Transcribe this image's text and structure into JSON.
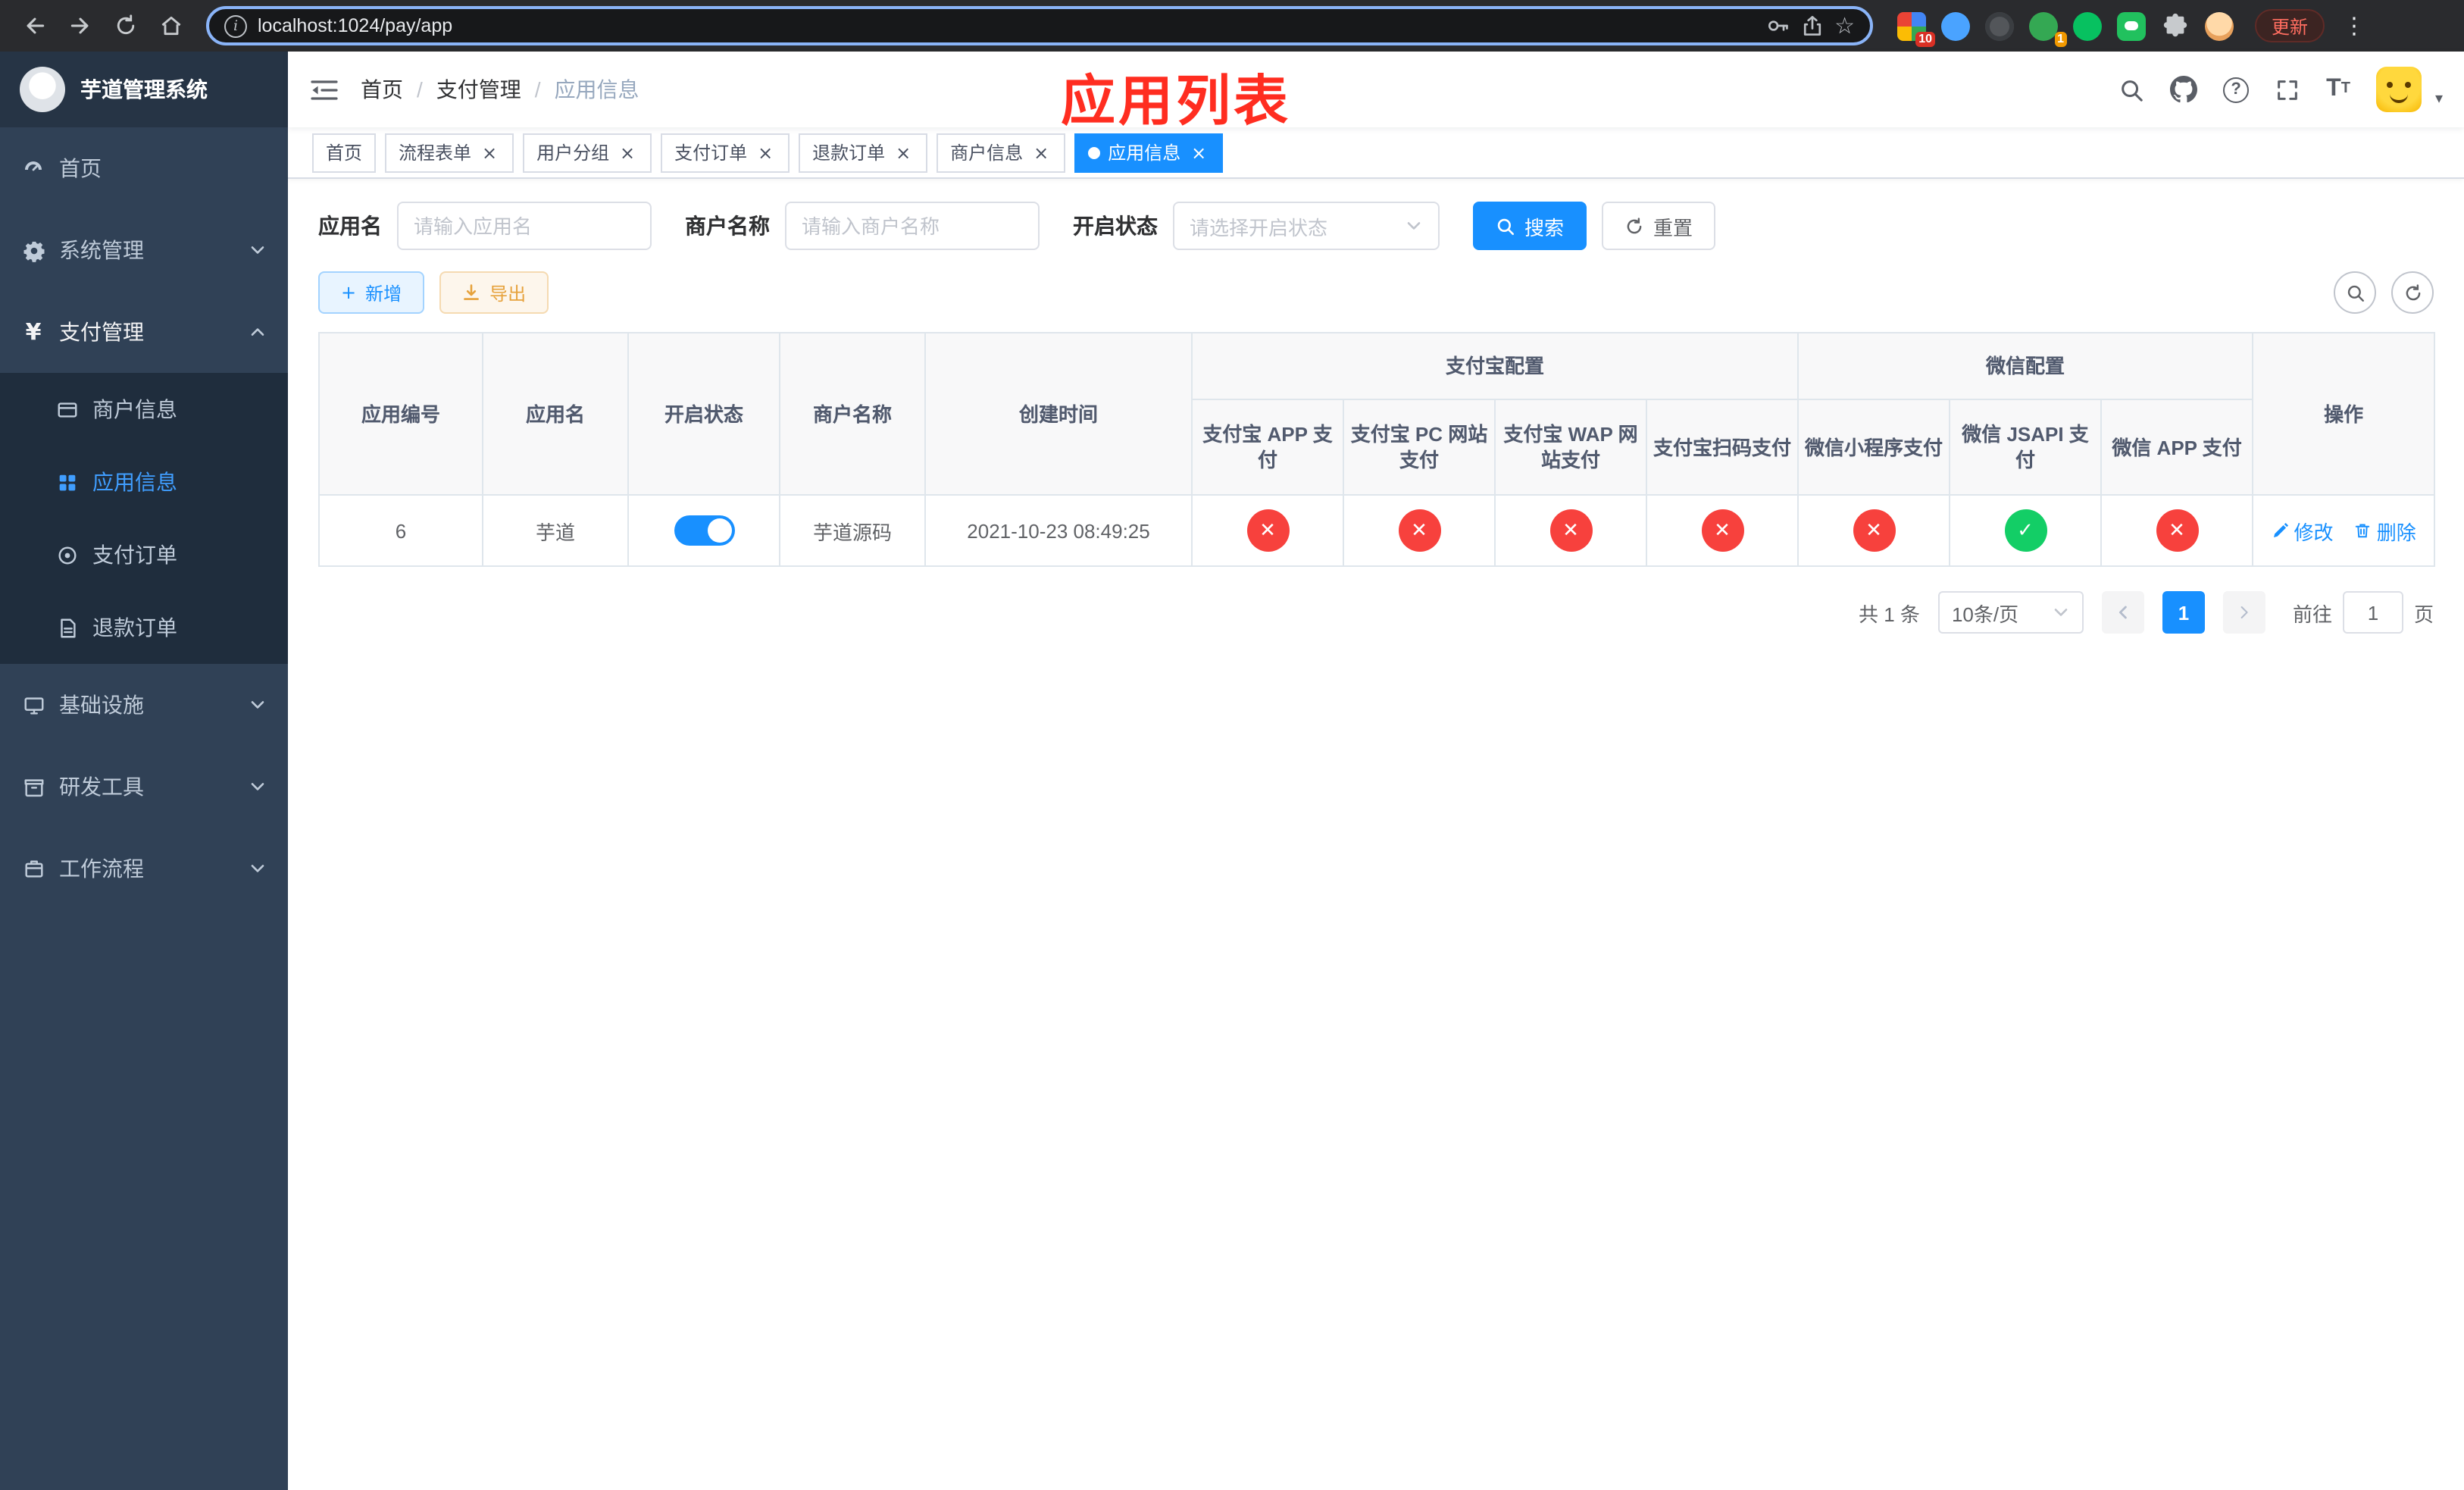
{
  "colors": {
    "accent": "#1890ff",
    "sidebar_active": "#409eff",
    "success": "#13ce66",
    "danger": "#f7413d",
    "warning": "#e6a23c",
    "annotation_red": "#ff2d20",
    "sidebar_bg": "#304156",
    "submenu_bg": "#1f2d3d"
  },
  "icons": {
    "close": "×",
    "plus": "+",
    "yen": "¥",
    "star": "☆",
    "kebab": "⋮",
    "caret_down": "▾",
    "question": "?",
    "info": "i",
    "font_large": "T",
    "font_small": "T"
  },
  "browser": {
    "url": "localhost:1024/pay/app",
    "update_label": "更新",
    "extensions": [
      {
        "name": "grid-extension",
        "badge": "10"
      },
      {
        "name": "drop-extension"
      },
      {
        "name": "dark-extension"
      },
      {
        "name": "green-avatar-extension",
        "badge": "1"
      },
      {
        "name": "wechat-extension"
      },
      {
        "name": "chat-extension"
      },
      {
        "name": "puzzle-extension"
      },
      {
        "name": "face-extension"
      }
    ]
  },
  "sidebar": {
    "title": "芋道管理系统",
    "items": [
      {
        "label": "首页"
      },
      {
        "label": "系统管理"
      },
      {
        "label": "支付管理",
        "expanded": true,
        "children": [
          {
            "label": "商户信息"
          },
          {
            "label": "应用信息",
            "active": true
          },
          {
            "label": "支付订单"
          },
          {
            "label": "退款订单"
          }
        ]
      },
      {
        "label": "基础设施"
      },
      {
        "label": "研发工具"
      },
      {
        "label": "工作流程"
      }
    ]
  },
  "header": {
    "breadcrumb": [
      {
        "label": "首页"
      },
      {
        "label": "支付管理"
      },
      {
        "label": "应用信息"
      }
    ],
    "annotation": "应用列表"
  },
  "tabs": [
    {
      "label": "首页",
      "closable": false
    },
    {
      "label": "流程表单",
      "closable": true
    },
    {
      "label": "用户分组",
      "closable": true
    },
    {
      "label": "支付订单",
      "closable": true
    },
    {
      "label": "退款订单",
      "closable": true
    },
    {
      "label": "商户信息",
      "closable": true
    },
    {
      "label": "应用信息",
      "closable": true,
      "active": true
    }
  ],
  "filters": {
    "app_name": {
      "label": "应用名",
      "placeholder": "请输入应用名"
    },
    "merchant_name": {
      "label": "商户名称",
      "placeholder": "请输入商户名称"
    },
    "status": {
      "label": "开启状态",
      "placeholder": "请选择开启状态"
    },
    "search_label": "搜索",
    "reset_label": "重置"
  },
  "toolbar": {
    "add_label": "新增",
    "export_label": "导出"
  },
  "table": {
    "columns": {
      "app_id": "应用编号",
      "app_name": "应用名",
      "status": "开启状态",
      "merchant": "商户名称",
      "created": "创建时间",
      "actions": "操作"
    },
    "groups": [
      {
        "label": "支付宝配置",
        "children": [
          "支付宝 APP 支付",
          "支付宝 PC 网站支付",
          "支付宝 WAP 网站支付",
          "支付宝扫码支付"
        ]
      },
      {
        "label": "微信配置",
        "children": [
          "微信小程序支付",
          "微信 JSAPI 支付",
          "微信 APP 支付"
        ]
      }
    ],
    "rows": [
      {
        "app_id": "6",
        "app_name": "芋道",
        "enabled": "on",
        "merchant": "芋道源码",
        "created": "2021-10-23 08:49:25",
        "channels": [
          "off",
          "off",
          "off",
          "off",
          "off",
          "on",
          "off"
        ],
        "edit_label": "修改",
        "delete_label": "删除"
      }
    ]
  },
  "pagination": {
    "total_text": "共 1 条",
    "page_size_text": "10条/页",
    "current_page": "1",
    "goto_label": "前往",
    "goto_value": "1",
    "goto_unit": "页"
  }
}
